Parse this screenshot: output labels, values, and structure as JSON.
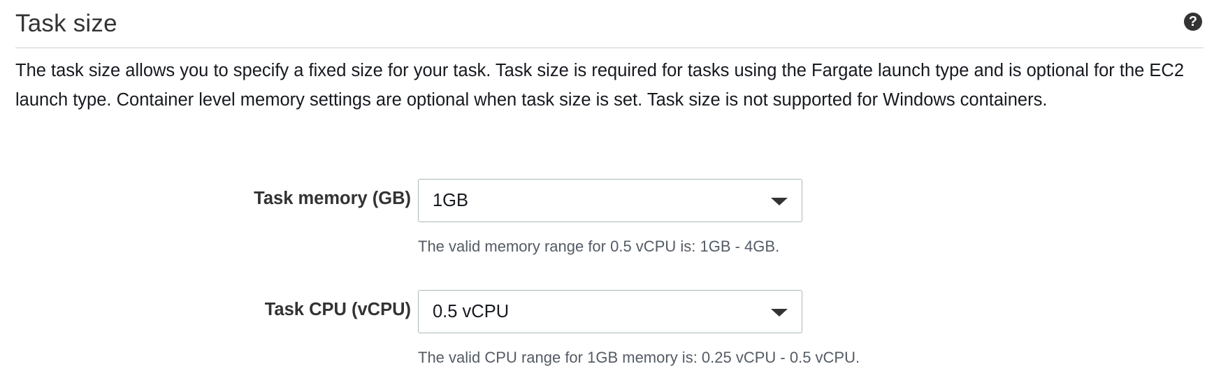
{
  "section": {
    "title": "Task size",
    "help_icon": "question-circle-icon",
    "description": "The task size allows you to specify a fixed size for your task. Task size is required for tasks using the Fargate launch type and is optional for the EC2 launch type. Container level memory settings are optional when task size is set. Task size is not supported for Windows containers."
  },
  "fields": {
    "memory": {
      "label": "Task memory (GB)",
      "value": "1GB",
      "hint": "The valid memory range for 0.5 vCPU is: 1GB - 4GB.",
      "icon": "caret-down-icon"
    },
    "cpu": {
      "label": "Task CPU (vCPU)",
      "value": "0.5 vCPU",
      "hint": "The valid CPU range for 1GB memory is: 0.25 vCPU - 0.5 vCPU.",
      "icon": "caret-down-icon"
    }
  }
}
